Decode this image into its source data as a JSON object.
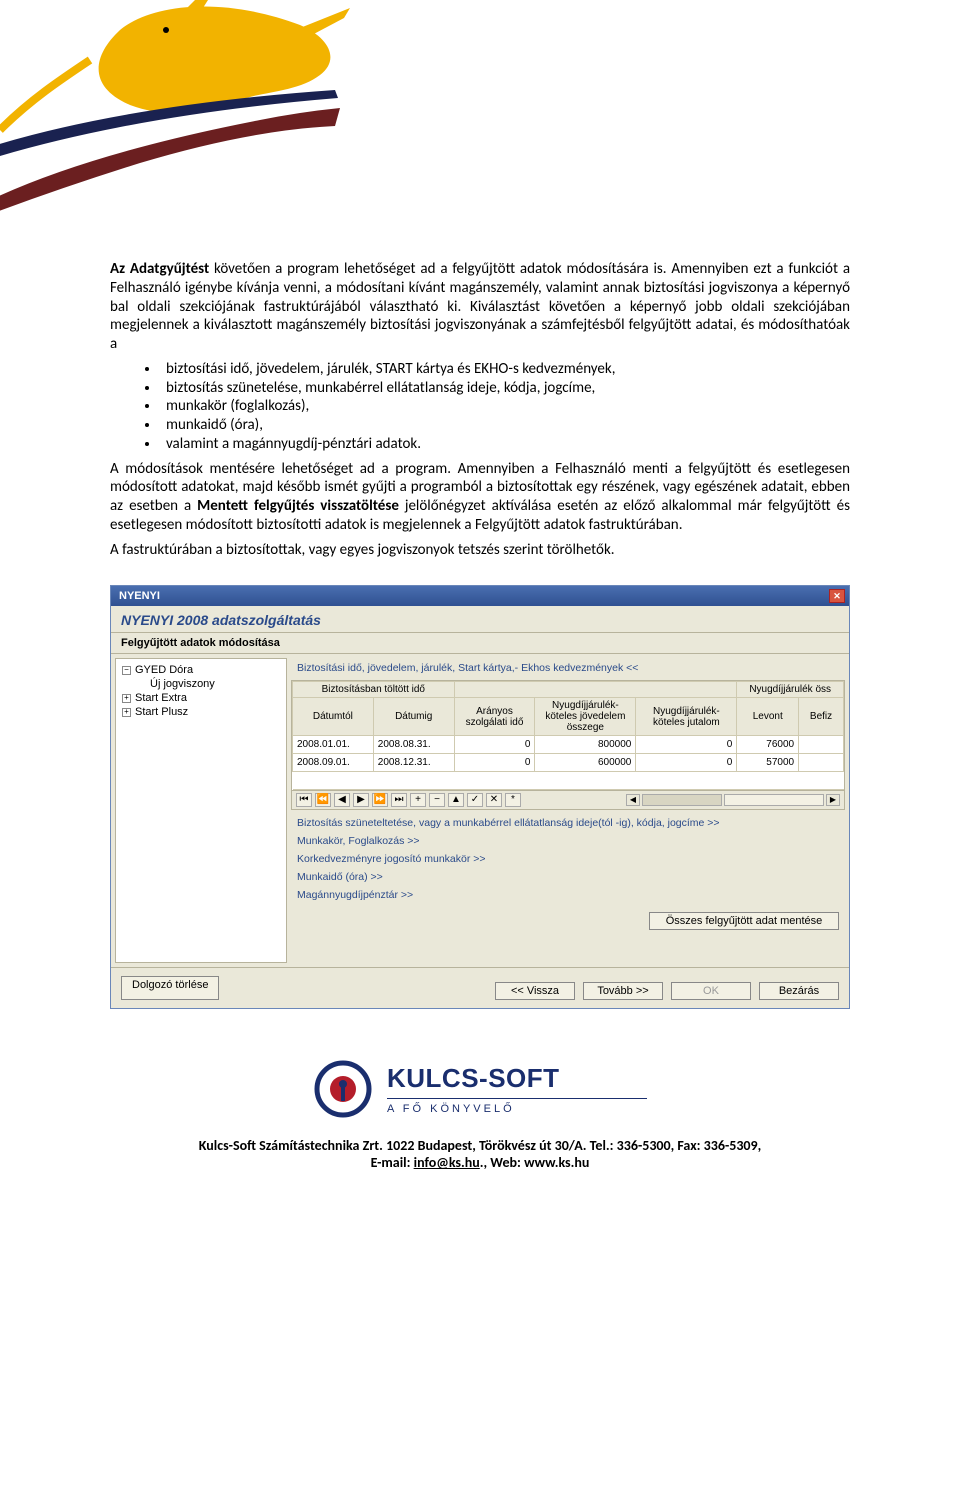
{
  "doc": {
    "p1_lead": "Az Adatgyűjtést",
    "p1_rest": " követően a program lehetőséget ad a felgyűjtött adatok módosítására is. Amennyiben ezt a funkciót a Felhasználó igénybe kívánja venni, a módosítani kívánt magánszemély, valamint annak biztosítási jogviszonya a képernyő bal oldali szekciójának fastruktúrájából választható ki. Kiválasztást követően a képernyő jobb oldali szekciójában megjelennek a kiválasztott magánszemély biztosítási jogviszonyának a számfejtésből felgyűjtött adatai, és módosíthatóak a",
    "bullet1": "biztosítási idő, jövedelem, járulék, START kártya és EKHO-s kedvezmények,",
    "bullet2": "biztosítás szünetelése, munkabérrel ellátatlanság ideje, kódja, jogcíme,",
    "bullet3": "munkakör (foglalkozás),",
    "bullet4": "munkaidő (óra),",
    "bullet5": "valamint a magánnyugdíj-pénztári adatok.",
    "p2a": "A módosítások mentésére lehetőséget ad a program. Amennyiben a Felhasználó menti a felgyűjtött és esetlegesen módosított adatokat, majd később ismét gyűjti a programból a biztosítottak egy részének, vagy egészének adatait, ebben az esetben a ",
    "p2bold": "Mentett felgyűjtés visszatöltése",
    "p2b": " jelölőnégyzet aktíválása esetén az előző alkalommal már felgyűjtött és esetlegesen módosított biztosítotti adatok is megjelennek a Felgyűjtött adatok fastruktúrában.",
    "p3": "A fastruktúrában a biztosítottak, vagy egyes jogviszonyok tetszés szerint törölhetők."
  },
  "app": {
    "title": "NYENYI",
    "subtitle": "NYENYI 2008 adatszolgáltatás",
    "section": "Felgyűjtött adatok módosítása",
    "tree": {
      "item1": "GYED Dóra",
      "item1sub": "Új jogviszony",
      "item2": "Start Extra",
      "item3": "Start Plusz"
    },
    "expand_link": "Biztosítási idő, jövedelem, járulék, Start kártya,- Ekhos kedvezmények <<",
    "grid": {
      "group1": "Biztosításban töltött idő",
      "group2": "",
      "group3": "Nyugdíjjárulék öss",
      "col1": "Dátumtól",
      "col2": "Dátumig",
      "col3": "Arányos szolgálati idő",
      "col4": "Nyugdíjjárulék-köteles jövedelem összege",
      "col5": "Nyugdíjjárulék-köteles jutalom",
      "col6": "Levont",
      "col7": "Befiz",
      "r1c1": "2008.01.01.",
      "r1c2": "2008.08.31.",
      "r1c3": "0",
      "r1c4": "800000",
      "r1c5": "0",
      "r1c6": "76000",
      "r2c1": "2008.09.01.",
      "r2c2": "2008.12.31.",
      "r2c3": "0",
      "r2c4": "600000",
      "r2c5": "0",
      "r2c6": "57000"
    },
    "links": {
      "l1": "Biztosítás szüneteltetése, vagy a munkabérrel ellátatlanság ideje(tól -ig), kódja, jogcíme >>",
      "l2": "Munkakör, Foglalkozás >>",
      "l3": "Korkedvezményre jogosító munkakör >>",
      "l4": "Munkaidő (óra) >>",
      "l5": "Magánnyugdíjpénztár >>"
    },
    "buttons": {
      "save_all": "Összes felgyűjtött adat mentése",
      "delete_worker": "Dolgozó törlése",
      "back": "<< Vissza",
      "next": "Tovább >>",
      "ok": "OK",
      "close": "Bezárás"
    }
  },
  "footer": {
    "logo_main": "KULCS-SOFT",
    "logo_sub": "A FŐ KÖNYVELŐ",
    "line1": "Kulcs-Soft Számítástechnika Zrt. 1022 Budapest, Törökvész út 30/A. Tel.: 336-5300, Fax: 336-5309,",
    "line2a": "E-mail: ",
    "email": "info@ks.hu",
    "line2b": "., Web: www.ks.hu"
  }
}
